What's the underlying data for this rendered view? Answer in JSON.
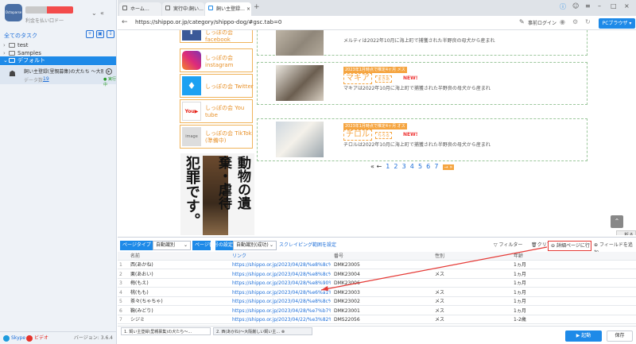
{
  "sidebar": {
    "logo": "Octoparse",
    "user_id": "利金を払い口ド一",
    "all_tasks": "全てのタスク",
    "folders": [
      "test",
      "Samples",
      "デフォルト"
    ],
    "task": {
      "title": "飼い主登録(里親募集)の犬たち ～大阪厳しい…",
      "count_label": "データ数:",
      "count": "19",
      "status": "● 実行中"
    },
    "footer": {
      "skype": "Skype",
      "video": "ビデオ",
      "version": "バージョン: 3.6.4"
    }
  },
  "browser": {
    "tabs": [
      "ホーム…",
      "実行中:飼い…",
      "飼い主登録…"
    ],
    "url": "https://shippo.or.jp/category/shippo-dog/#gsc.tab=0",
    "login": "事前ログイン",
    "pc_browser": "PCブラウザ"
  },
  "webpage": {
    "sns": [
      {
        "icon": "facebook-icon",
        "label": "しっぽの会\nfacebook"
      },
      {
        "icon": "instagram-icon",
        "label": "しっぽの会\ninstagram"
      },
      {
        "icon": "twitter-icon",
        "label": "しっぽの会 Twitter"
      },
      {
        "icon": "youtube-icon",
        "label": "しっぽの会 You\ntube"
      },
      {
        "icon": "image-icon",
        "label": "しっぽの会 TikTok\n(準備中)"
      }
    ],
    "poster_text": "犯罪です。",
    "poster_text2": "動物の遺棄・虐待",
    "dogs": [
      {
        "date": "",
        "name": "",
        "kana": "",
        "new": "",
        "desc": "メルティは2022年10月に海上町で捕獲された半野良の母犬から産まれ"
      },
      {
        "date": "2023年1月時点で推定4ヶ月 メス",
        "name": "マキア",
        "kana": "まきあ",
        "new": "NEW!",
        "desc": "マキアは2022年10月に海上町で捕獲された半野良の母犬から産まれ"
      },
      {
        "date": "2023年1月時点で推定4ヶ月 オス",
        "name": "チロル",
        "kana": "ちろる",
        "new": "NEW!",
        "desc": "チロルは2022年10月に海上町で捕獲された半野良の母犬から産まれ"
      }
    ],
    "pager": {
      "prev": "« ←",
      "pages": [
        "1",
        "2",
        "3",
        "4",
        "5",
        "6",
        "7"
      ],
      "next": "→ »"
    },
    "fold": "折る"
  },
  "panel": {
    "page_type_label": "ページタイプ",
    "page_type_value": "自動識別",
    "page_num_label": "ページ番号の設定",
    "page_num_value": "自動識別(成功)",
    "scraping_link": "スクレイピング範囲を設定",
    "filter": "フィルター",
    "clear": "クリア",
    "detail": "詳細ページに行く",
    "add_field": "フィールドを追加",
    "columns": [
      "",
      "名前",
      "リンク",
      "番号",
      "性別",
      "年齢"
    ],
    "rows": [
      [
        "1",
        "西(あかね)",
        "https://shippo.or.jp/2023/04/28/%e8%8c%a3%8...",
        "DMK23005",
        "",
        "1ヵ月"
      ],
      [
        "2",
        "栗(あおい)",
        "https://shippo.or.jp/2023/04/28/%e8%8c%a3%8...",
        "DMK23004",
        "メス",
        "1ヵ月"
      ],
      [
        "3",
        "梅(もえ)",
        "https://shippo.or.jp/2023/04/28/%e8%90%81%e3%8...",
        "DMK23006",
        "",
        "1ヵ月"
      ],
      [
        "4",
        "桃(もも)",
        "https://shippo.or.jp/2023/04/28/%e6%a1%83%e3%8...",
        "DMK23003",
        "メス",
        "1ヵ月"
      ],
      [
        "5",
        "茶々(ちゃちゃ)",
        "https://shippo.or.jp/2023/04/28/%e8%8c%b6%e3%8...",
        "DMK23002",
        "メス",
        "1ヵ月"
      ],
      [
        "6",
        "鞠(みどり)",
        "https://shippo.or.jp/2023/04/28/%e7%b7%a2%e3%8...",
        "DMK23001",
        "メス",
        "1ヵ月"
      ],
      [
        "7",
        "シジミ",
        "https://shippo.or.jp/2023/04/22/%e3%82%b7%e3%8...",
        "DMS22056",
        "メス",
        "1-2歳"
      ]
    ],
    "tabs": [
      "1. 飼い主登録(里親募集)の犬たち～…",
      "2. 西(あかね)～大阪厳しい飼い主…"
    ],
    "run": "▶ 起動",
    "save": "保存"
  },
  "colors": {
    "accent": "#1e8ae8",
    "orange": "#f5a541",
    "highlight": "#e53935"
  }
}
